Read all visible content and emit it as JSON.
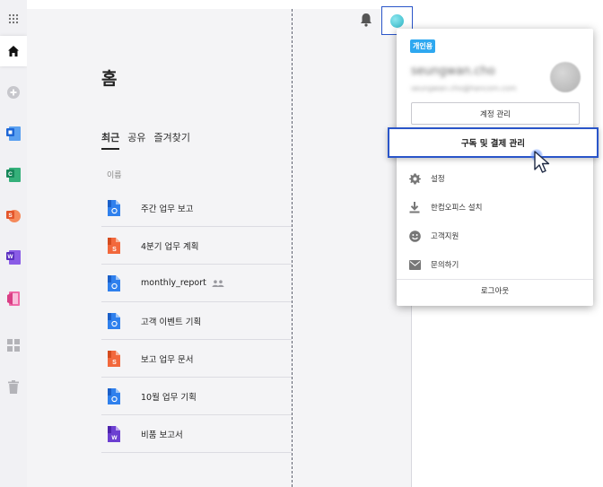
{
  "app": {
    "home_title": "홈"
  },
  "tabs": [
    {
      "label": "최근",
      "active": true
    },
    {
      "label": "공유",
      "active": false
    },
    {
      "label": "즐겨찾기",
      "active": false
    }
  ],
  "file_list": {
    "column_name": "이름",
    "rows": [
      {
        "name": "주간 업무 보고",
        "type": "doc",
        "shared": false
      },
      {
        "name": "4분기 업무 계획",
        "type": "slide",
        "shared": false
      },
      {
        "name": "monthly_report",
        "type": "doc",
        "shared": true
      },
      {
        "name": "고객 이벤트 기획",
        "type": "doc",
        "shared": false
      },
      {
        "name": "보고 업무 문서",
        "type": "slide",
        "shared": false
      },
      {
        "name": "10월 업무 기획",
        "type": "doc",
        "shared": false
      },
      {
        "name": "비품 보고서",
        "type": "word",
        "shared": false
      }
    ]
  },
  "sidebar": {
    "items": [
      {
        "icon": "apps-grid-icon"
      },
      {
        "icon": "home-icon",
        "active": true
      },
      {
        "icon": "add-icon"
      },
      {
        "icon": "cell-app-icon"
      },
      {
        "icon": "calc-app-icon"
      },
      {
        "icon": "show-app-icon"
      },
      {
        "icon": "word-app-icon"
      },
      {
        "icon": "note-app-icon"
      },
      {
        "icon": "dashboard-icon"
      },
      {
        "icon": "trash-icon"
      }
    ]
  },
  "account_menu": {
    "badge": "개인용",
    "user_name": "seungwan.cho",
    "user_email": "seungwan.cho@hancom.com",
    "manage_account_label": "계정 관리",
    "subscription_label": "구독 및 결제 관리",
    "items": [
      {
        "label": "설정",
        "icon": "gear-icon"
      },
      {
        "label": "한컴오피스 설치",
        "icon": "download-icon"
      },
      {
        "label": "고객지원",
        "icon": "smile-icon"
      },
      {
        "label": "문의하기",
        "icon": "mail-icon"
      }
    ],
    "logout_label": "로그아웃"
  },
  "colors": {
    "accent_blue": "#2a55c9",
    "badge_blue": "#2ea8f0",
    "doc_blue": "#2f80ed",
    "slide_orange": "#f2683c",
    "word_purple": "#6c3fd1"
  }
}
